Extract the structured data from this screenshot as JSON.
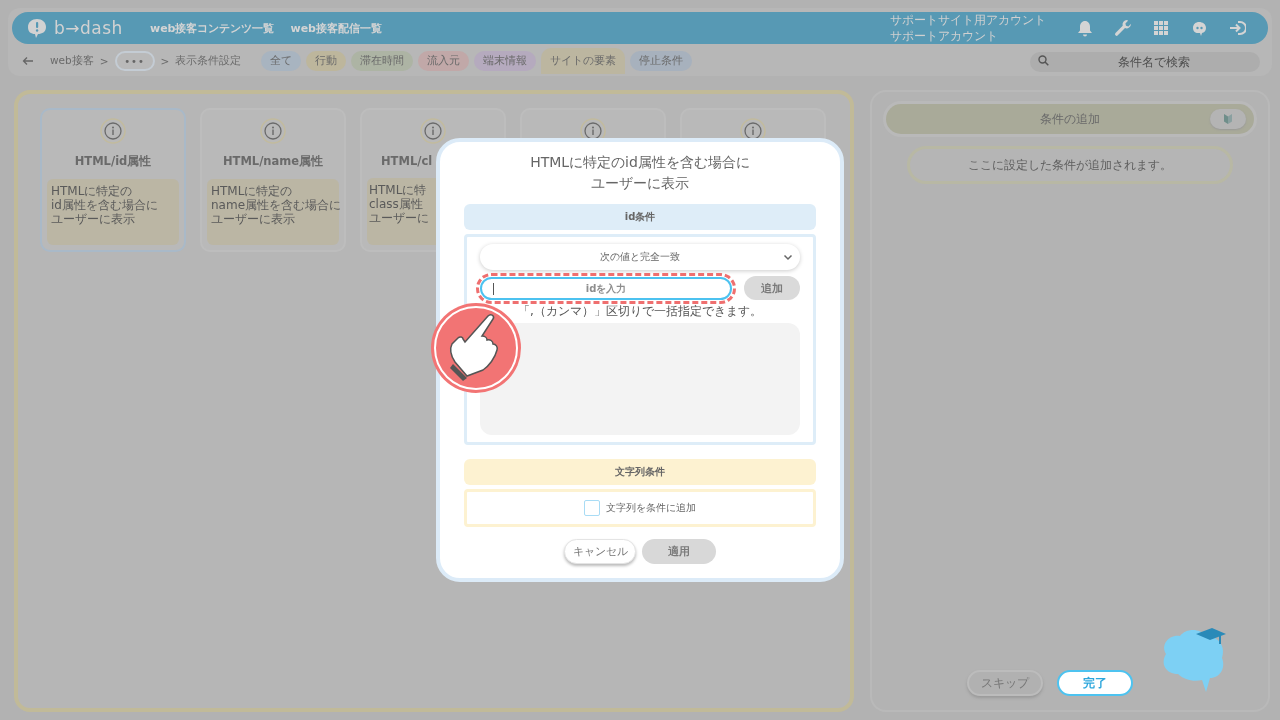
{
  "header": {
    "logo": "b→dash",
    "nav": [
      "web接客コンテンツ一覧",
      "web接客配信一覧"
    ],
    "account": [
      "サポートサイト用アカウント",
      "サポートアカウント"
    ]
  },
  "breadcrumb": [
    {
      "kind": "link",
      "label": "web接客"
    },
    {
      "kind": "separator",
      "label": ">"
    },
    {
      "kind": "more",
      "label": "•••"
    },
    {
      "kind": "separator",
      "label": ">"
    },
    {
      "kind": "current",
      "label": "表示条件設定"
    }
  ],
  "filters": [
    {
      "label": "全て",
      "color": "#a8b4c0",
      "selected": false
    },
    {
      "label": "行動",
      "color": "#bdb69c",
      "selected": false
    },
    {
      "label": "滞在時間",
      "color": "#adb4a4",
      "selected": false
    },
    {
      "label": "流入元",
      "color": "#c1a8a8",
      "selected": false
    },
    {
      "label": "端末情報",
      "color": "#b5aabe",
      "selected": false
    },
    {
      "label": "サイトの要素",
      "color": "#bcb6a0",
      "selected": true
    },
    {
      "label": "停止条件",
      "color": "#a7b1bd",
      "selected": false
    }
  ],
  "search": {
    "placeholder": "条件名で検索"
  },
  "cards": [
    {
      "kind": "full",
      "title": "HTML/id属性",
      "description": [
        "HTMLに特定の",
        "id属性を含む場合に",
        "ユーザーに表示"
      ],
      "selected": true
    },
    {
      "kind": "full",
      "title": "HTML/name属性",
      "description": [
        "HTMLに特定の",
        "name属性を含む場合に",
        "ユーザーに表示"
      ],
      "selected": false
    },
    {
      "kind": "clipped",
      "title": "HTML/cl",
      "description": [
        "HTMLに特",
        "class属性",
        "ユーザーに"
      ],
      "selected": false
    },
    {
      "kind": "hidden",
      "selected": false
    },
    {
      "kind": "hidden",
      "selected": false
    }
  ],
  "modal": {
    "title": [
      "HTMLに特定のid属性を含む場合に",
      "ユーザーに表示"
    ],
    "id_section": {
      "heading": "id条件",
      "match": "次の値と完全一致",
      "placeholder": "idを入力",
      "add_button": {
        "label": "追加",
        "disabled": true
      },
      "hint": "「,（カンマ）」区切りで一括指定できます。"
    },
    "string_section": {
      "heading": "文字列条件",
      "checkbox": {
        "label": "文字列を条件に追加",
        "checked": false
      }
    },
    "buttons": [
      {
        "label": "キャンセル",
        "kind": "secondary"
      },
      {
        "label": "適用",
        "kind": "primary",
        "disabled": true
      }
    ]
  },
  "conditions_panel": {
    "heading": "条件の追加",
    "empty_message": "ここに設定した条件が追加されます。"
  },
  "footer_buttons": [
    {
      "label": "スキップ",
      "kind": "skip"
    },
    {
      "label": "完了",
      "kind": "done"
    }
  ]
}
